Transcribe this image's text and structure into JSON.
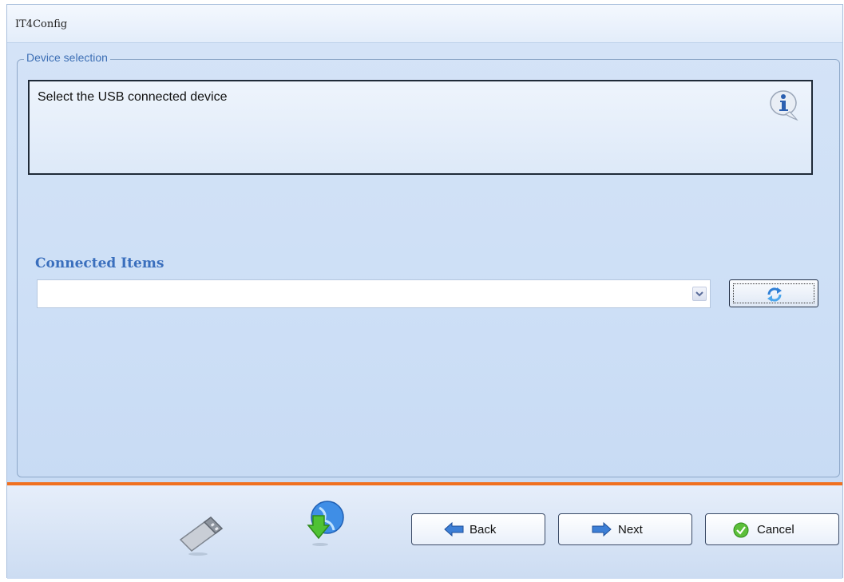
{
  "window": {
    "title": "IT4Config"
  },
  "device_selection": {
    "legend": "Device selection",
    "instruction": "Select the USB connected device",
    "info_icon": "info-icon"
  },
  "connected_items": {
    "label": "Connected Items",
    "selected_value": "",
    "refresh_icon": "refresh-icon"
  },
  "steps": [
    {
      "name": "usb-plug-icon",
      "state": "active"
    },
    {
      "name": "download-globe-icon",
      "state": "pending"
    }
  ],
  "buttons": {
    "back": "Back",
    "next": "Next",
    "cancel": "Cancel"
  },
  "colors": {
    "accent_orange": "#f07020",
    "label_blue": "#3a6fbd",
    "panel_bg": "#d8e6f8"
  }
}
